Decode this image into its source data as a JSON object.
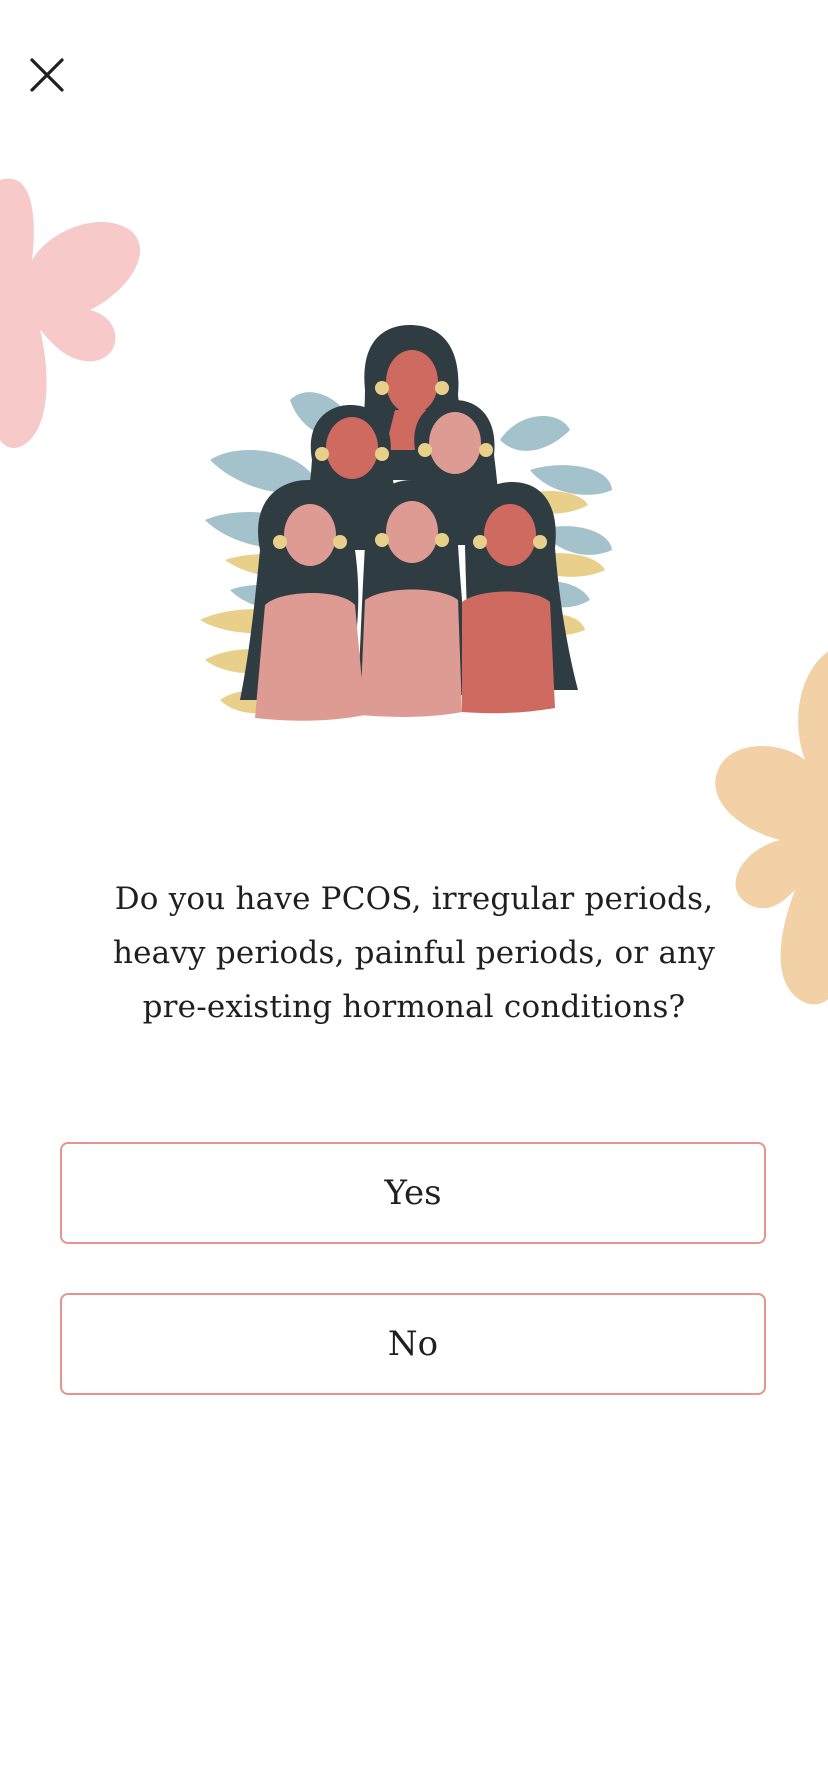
{
  "header": {
    "close_icon": "close-icon"
  },
  "question": {
    "text": "Do you have PCOS, irregular periods, heavy periods, painful periods, or any pre-existing hormonal conditions?"
  },
  "answers": [
    {
      "label": "Yes"
    },
    {
      "label": "No"
    }
  ],
  "colors": {
    "button_border": "#e8938e",
    "blob_pink": "#f7c9c9",
    "blob_peach": "#f3d1a6",
    "hair": "#2f3d42",
    "skin": "#cf6a61",
    "leaf_blue": "#a4c2cc",
    "leaf_yellow": "#e9d08a"
  }
}
